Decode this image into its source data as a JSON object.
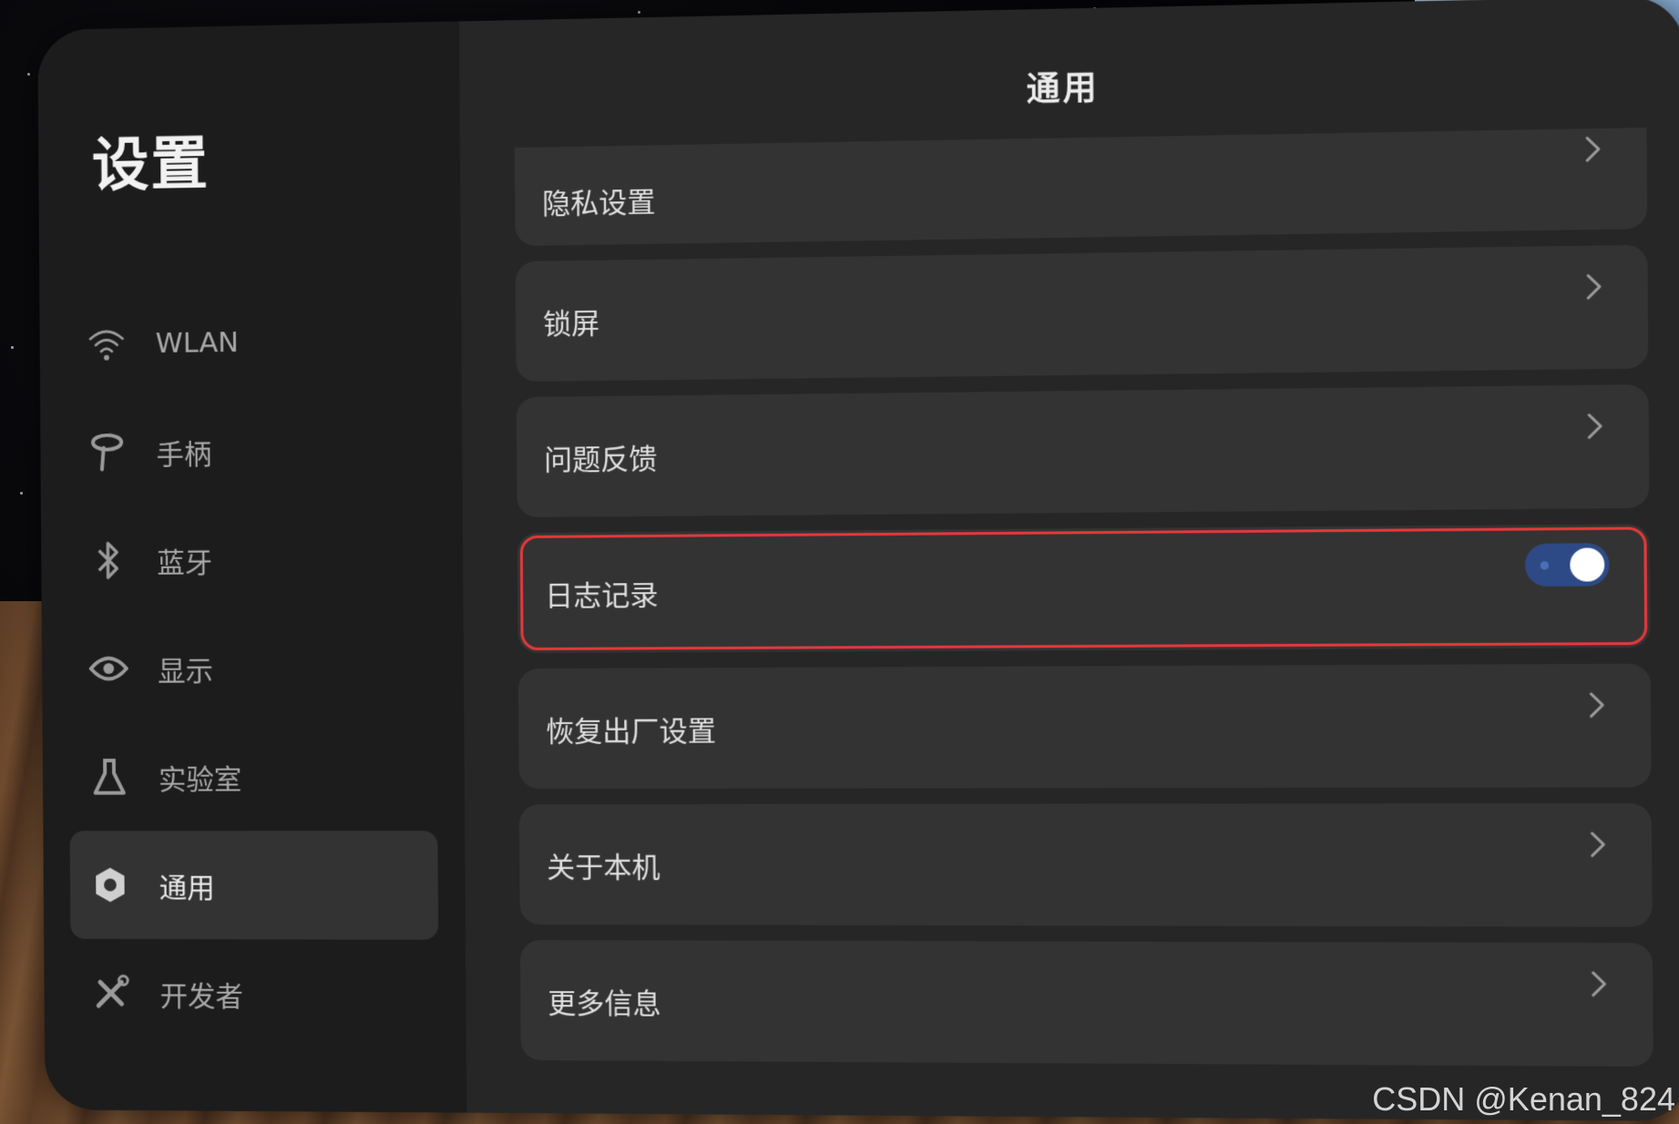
{
  "sidebar": {
    "title": "设置",
    "items": [
      {
        "label": "WLAN",
        "icon": "wifi-icon"
      },
      {
        "label": "手柄",
        "icon": "controller-icon"
      },
      {
        "label": "蓝牙",
        "icon": "bluetooth-icon"
      },
      {
        "label": "显示",
        "icon": "eye-icon"
      },
      {
        "label": "实验室",
        "icon": "flask-icon"
      },
      {
        "label": "通用",
        "icon": "gear-icon",
        "active": true
      },
      {
        "label": "开发者",
        "icon": "tools-icon"
      }
    ]
  },
  "main": {
    "title": "通用",
    "rows": [
      {
        "label": "隐私设置",
        "control": "chevron"
      },
      {
        "label": "锁屏",
        "control": "chevron"
      },
      {
        "label": "问题反馈",
        "control": "chevron"
      },
      {
        "label": "日志记录",
        "control": "toggle",
        "toggle_on": true,
        "highlighted": true
      },
      {
        "label": "恢复出厂设置",
        "control": "chevron"
      },
      {
        "label": "关于本机",
        "control": "chevron"
      },
      {
        "label": "更多信息",
        "control": "chevron"
      }
    ]
  },
  "watermark": "CSDN @Kenan_824",
  "colors": {
    "panel": "#262626",
    "sidebar": "#1c1c1c",
    "row": "#333333",
    "toggle_on": "#2d4a86",
    "highlight_border": "#e5383b"
  }
}
